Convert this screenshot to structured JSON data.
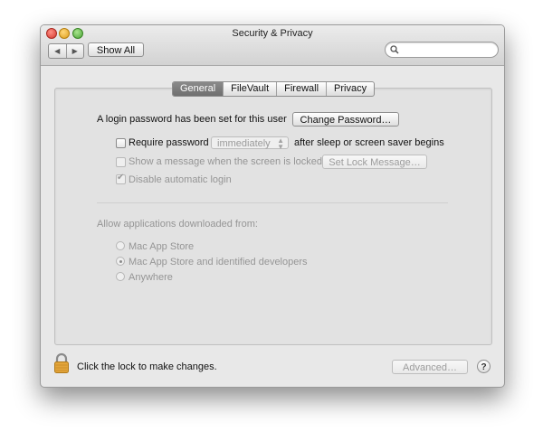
{
  "window": {
    "title": "Security & Privacy"
  },
  "toolbar": {
    "back_glyph": "◀",
    "forward_glyph": "▶",
    "show_all_label": "Show All",
    "search_placeholder": ""
  },
  "tabs": [
    {
      "label": "General",
      "active": true
    },
    {
      "label": "FileVault",
      "active": false
    },
    {
      "label": "Firewall",
      "active": false
    },
    {
      "label": "Privacy",
      "active": false
    }
  ],
  "general": {
    "login_text": "A login password has been set for this user",
    "change_password_label": "Change Password…",
    "require_password_label": "Require password",
    "require_password_checked": false,
    "require_password_value": "immediately",
    "after_sleep_text": "after sleep or screen saver begins",
    "show_message_label": "Show a message when the screen is locked",
    "show_message_checked": false,
    "set_lock_message_label": "Set Lock Message…",
    "disable_login_label": "Disable automatic login",
    "disable_login_checked": true,
    "allow_title": "Allow applications downloaded from:",
    "options": [
      {
        "label": "Mac App Store",
        "selected": false
      },
      {
        "label": "Mac App Store and identified developers",
        "selected": true
      },
      {
        "label": "Anywhere",
        "selected": false
      }
    ]
  },
  "footer": {
    "lock_text": "Click the lock to make changes.",
    "advanced_label": "Advanced…",
    "help_label": "?"
  },
  "colors": {
    "tab_active": "#7c7c7c",
    "lock": "#e0a43a",
    "disabled_text": "#959595"
  }
}
